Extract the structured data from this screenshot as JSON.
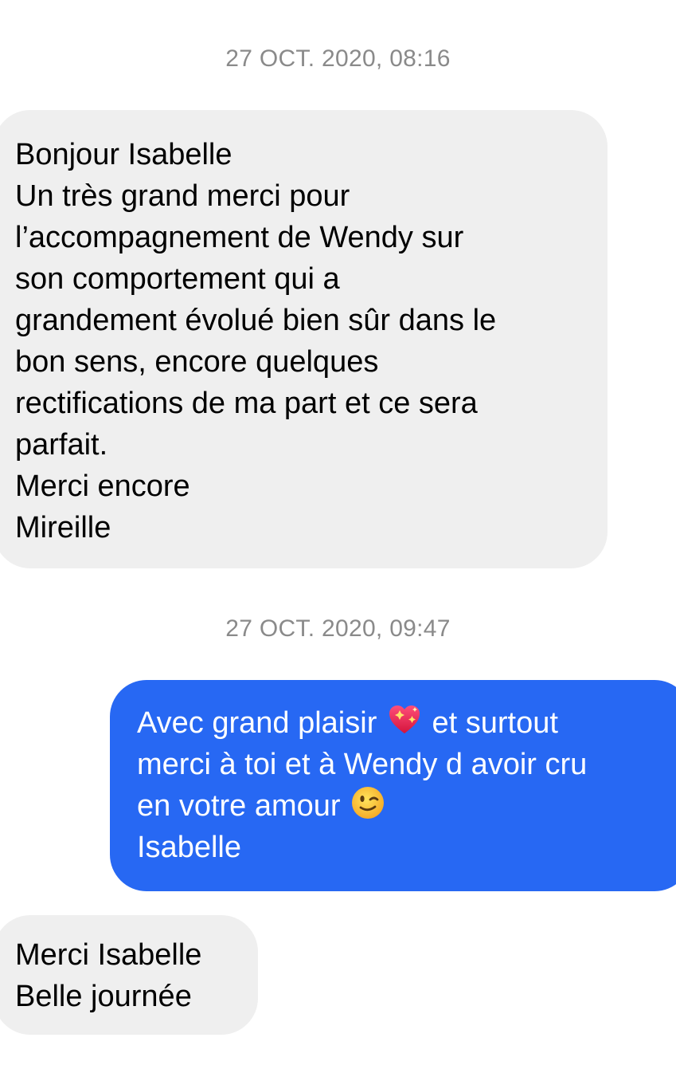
{
  "conversation": {
    "timestamp_1": "27 OCT. 2020, 08:16",
    "timestamp_2": "27 OCT. 2020, 09:47",
    "messages": [
      {
        "direction": "incoming",
        "lines": [
          "Bonjour Isabelle",
          "Un très grand merci pour",
          "l’accompagnement de Wendy sur",
          "son comportement qui a",
          "grandement évolué bien sûr dans le",
          "bon sens, encore quelques",
          "rectifications de ma part et ce sera",
          "parfait.",
          "Merci encore",
          "Mireille"
        ]
      },
      {
        "direction": "outgoing",
        "line_1_before_emoji": "Avec grand plaisir",
        "line_1_after_emoji": "et surtout",
        "line_2": "merci à toi et à Wendy d avoir cru",
        "line_3_before_emoji": "en votre amour",
        "line_4": "Isabelle",
        "emojis": [
          "sparkling-heart-icon",
          "winking-face-icon"
        ]
      },
      {
        "direction": "incoming",
        "lines": [
          "Merci Isabelle",
          "Belle journée"
        ]
      }
    ]
  },
  "colors": {
    "incoming_bubble": "#efefef",
    "outgoing_bubble": "#2768f3",
    "timestamp_text": "#8a8a8a"
  }
}
